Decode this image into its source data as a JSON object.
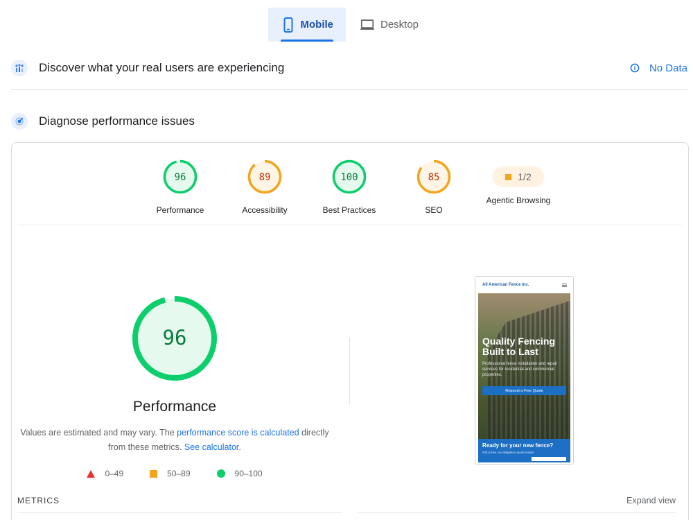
{
  "tabs": [
    {
      "label": "Mobile",
      "active": true,
      "icon": "smartphone-icon"
    },
    {
      "label": "Desktop",
      "active": false,
      "icon": "laptop-icon"
    }
  ],
  "field_data": {
    "title": "Discover what your real users are experiencing",
    "status": "No Data",
    "icon": "users-chart-icon"
  },
  "lab_data": {
    "title": "Diagnose performance issues",
    "icon": "lab-icon"
  },
  "scores": [
    {
      "label": "Performance",
      "value": 96,
      "color": "#0cce6b",
      "text_color": "#0b7a3f",
      "fill": "#e6f9ee"
    },
    {
      "label": "Accessibility",
      "value": 89,
      "color": "#f4a41d",
      "text_color": "#c33300",
      "fill": "#fff5e6"
    },
    {
      "label": "Best Practices",
      "value": 100,
      "color": "#0cce6b",
      "text_color": "#0b7a3f",
      "fill": "#e6f9ee"
    },
    {
      "label": "SEO",
      "value": 85,
      "color": "#f4a41d",
      "text_color": "#c33300",
      "fill": "#fff5e6"
    }
  ],
  "agentic": {
    "label": "Agentic Browsing",
    "value": "1/2"
  },
  "main_score": {
    "value": 96,
    "label": "Performance"
  },
  "note": {
    "prefix": "Values are estimated and may vary. The ",
    "link1": "performance score is calculated",
    "middle": " directly from these metrics. ",
    "link2": "See calculator",
    "suffix": "."
  },
  "legend": [
    {
      "range": "0–49",
      "shape": "triangle",
      "color": "#e5332a"
    },
    {
      "range": "50–89",
      "shape": "square",
      "color": "#f4a41d"
    },
    {
      "range": "90–100",
      "shape": "circle",
      "color": "#0cce6b"
    }
  ],
  "metrics": {
    "title": "METRICS",
    "expand": "Expand view"
  },
  "screenshot": {
    "site_name": "All American Fence Inc.",
    "hero_title_1": "Quality Fencing",
    "hero_title_2": "Built to Last",
    "hero_sub": "Professional fence installation and repair services for residential and commercial properties.",
    "cta": "Request a Free Quote",
    "footer_title": "Ready for your new fence?",
    "footer_sub": "Get a free, no-obligation quote today!"
  }
}
